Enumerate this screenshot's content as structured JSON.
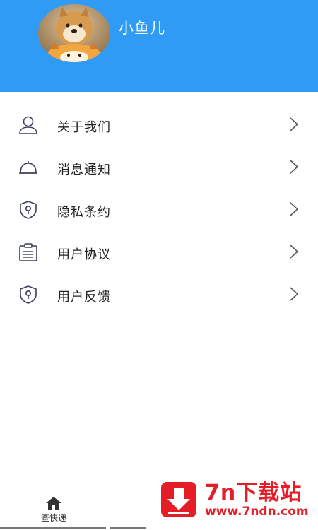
{
  "profile": {
    "username": "小鱼儿",
    "header_color": "#2f9bf5"
  },
  "menu": {
    "items": [
      {
        "label": "关于我们",
        "icon": "user-icon"
      },
      {
        "label": "消息通知",
        "icon": "bell-icon"
      },
      {
        "label": "隐私条约",
        "icon": "shield-icon"
      },
      {
        "label": "用户协议",
        "icon": "clipboard-icon"
      },
      {
        "label": "用户反馈",
        "icon": "shield-icon"
      }
    ]
  },
  "tabbar": {
    "home_label": "查快递",
    "home_icon": "home-icon"
  },
  "watermark": {
    "title": "7n下载站",
    "url": "www.7ndn.com",
    "color": "#e51d26"
  }
}
